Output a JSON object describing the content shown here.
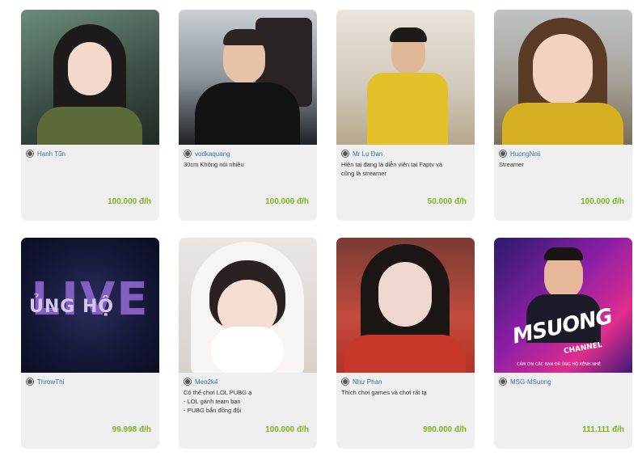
{
  "cards": [
    {
      "name": "Hạnh Tũn",
      "desc": "",
      "price": "100.000 đ/h"
    },
    {
      "name": "vodkaquang",
      "desc": "30cm Không nói nhiều",
      "price": "100.000 đ/h"
    },
    {
      "name": "Mr Lụ Đan",
      "desc": "Hiện tại đang là diễn viên tại Faptv và\ncũng là streamer",
      "price": "50.000 đ/h"
    },
    {
      "name": "HuongNnii",
      "desc": "Streamer",
      "price": "100.000 đ/h"
    },
    {
      "name": "ThrowThi",
      "desc": "",
      "price": "99.998 đ/h",
      "image_text": {
        "big": "LIVE",
        "small": "ỦNG HỘ"
      }
    },
    {
      "name": "Meo2k4",
      "desc": "Có thể chơi LOL PUBG ạ\n- LOL gánh team bạn\n- PUBG bắn đồng đội",
      "price": "100.000 đ/h"
    },
    {
      "name": "Như Phan",
      "desc": "Thích chơi games và chơi rất tạ",
      "price": "990.000 đ/h"
    },
    {
      "name": "MSG-MSuong",
      "desc": "",
      "price": "111.111 đ/h",
      "image_text": {
        "big": "MSUONG",
        "small": "CHANNEL",
        "thanks": "CẢM ƠN CÁC BẠN ĐÃ ỦNG HỘ KÊNH NHÉ"
      }
    }
  ],
  "colors": {
    "price": "#7ab51d",
    "name": "#3a6fb0",
    "card_bg": "#efefef"
  },
  "icons": {
    "status": "radio-status-icon"
  }
}
